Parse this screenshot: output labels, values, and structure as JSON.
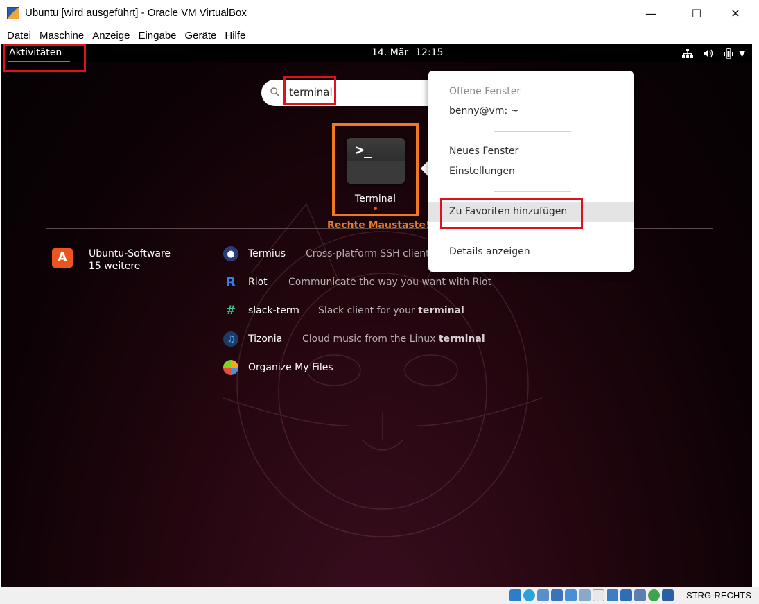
{
  "window": {
    "title": "Ubuntu [wird ausgeführt] - Oracle VM VirtualBox",
    "controls": [
      "minimize",
      "maximize",
      "close"
    ]
  },
  "menubar": {
    "items": [
      "Datei",
      "Maschine",
      "Anzeige",
      "Eingabe",
      "Geräte",
      "Hilfe"
    ]
  },
  "topbar": {
    "activities": "Aktivitäten",
    "date": "14. Mär",
    "time": "12:15"
  },
  "search": {
    "value": "terminal"
  },
  "app_grid": {
    "app_label": "Terminal",
    "prompt_glyph": ">_"
  },
  "annotation": {
    "hint": "Rechte Maustaste!"
  },
  "provider": {
    "name": "Ubuntu-Software",
    "more": "15 weitere"
  },
  "results": [
    {
      "name": "Termius",
      "desc": "Cross-platform SSH client",
      "desc_bold": ""
    },
    {
      "name": "Riot",
      "desc": "Communicate the way you want with Riot",
      "desc_bold": ""
    },
    {
      "name": "slack-term",
      "desc": "Slack client for your ",
      "desc_bold": "terminal"
    },
    {
      "name": "Tizonia",
      "desc": "Cloud music from the Linux ",
      "desc_bold": "terminal"
    },
    {
      "name": "Organize My Files",
      "desc": "",
      "desc_bold": ""
    }
  ],
  "context_menu": {
    "header": "Offene Fenster",
    "window_item": "benny@vm: ~",
    "new_window": "Neues Fenster",
    "settings": "Einstellungen",
    "add_favorite": "Zu Favoriten hinzufügen",
    "details": "Details anzeigen"
  },
  "statusbar": {
    "host_key": "STRG-RECHTS"
  },
  "colors": {
    "accent": "#e95420",
    "highlight_red": "#e0101e",
    "highlight_orange": "#f07a21"
  }
}
